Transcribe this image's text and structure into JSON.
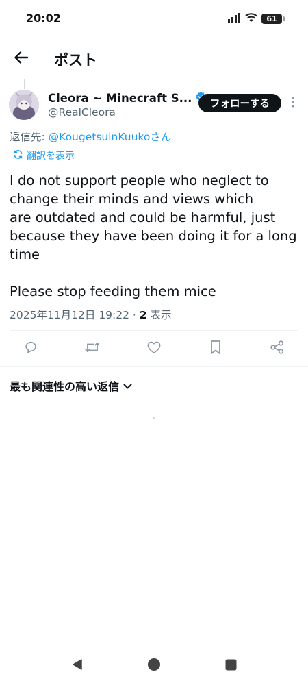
{
  "status_bar": {
    "time": "20:02",
    "battery": "61"
  },
  "header": {
    "title": "ポスト"
  },
  "tweet": {
    "display_name": "Cleora ~ Minecraft S...",
    "handle": "@RealCleora",
    "follow_label": "フォローする",
    "reply_prefix": "返信先:",
    "reply_mention": "@KougetsuinKuuko",
    "reply_suffix": "さん",
    "translate_label": "翻訳を表示",
    "text": "I do not support people who neglect to\nchange their minds and views which\nare outdated and could be harmful, just\nbecause they have been doing it for a long\ntime\n\nPlease stop feeding them mice",
    "timestamp": "2025年11月12日 19:22",
    "separator": " · ",
    "views_count": "2",
    "views_label": " 表示"
  },
  "replies": {
    "sort_label": "最も関連性の高い返信"
  },
  "colors": {
    "accent": "#1d9bf0",
    "text_primary": "#0f1419",
    "text_secondary": "#536471",
    "icon": "#536471",
    "divider": "#eff3f4"
  }
}
